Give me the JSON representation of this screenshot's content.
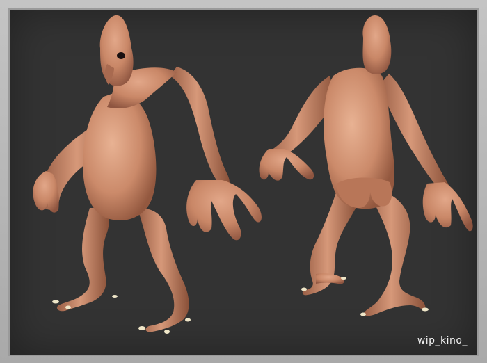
{
  "watermark": "wip_kino_",
  "colors": {
    "background": "#333333",
    "frame": "#b8b8b8",
    "skin": "#c98767",
    "skin_shadow": "#8e5540",
    "skin_highlight": "#e2a789",
    "claw": "#efe6c8"
  },
  "figures": [
    {
      "view": "front-three-quarter"
    },
    {
      "view": "back-three-quarter"
    }
  ]
}
